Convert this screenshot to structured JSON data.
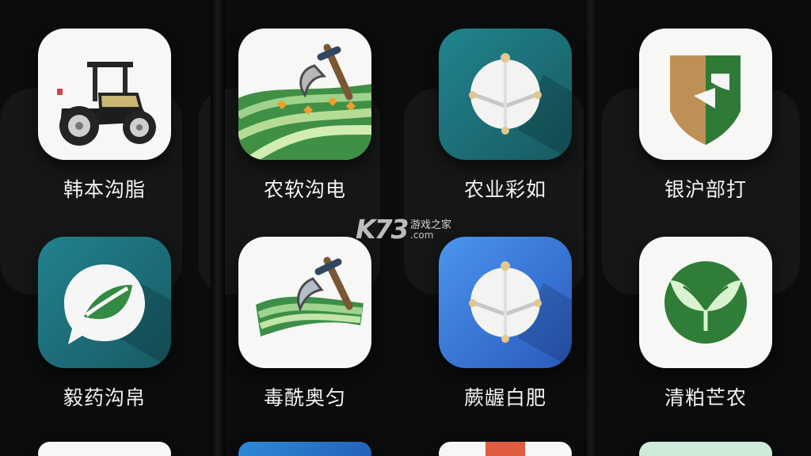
{
  "apps": [
    {
      "label": "韩本沟脂",
      "icon": "tractor-icon"
    },
    {
      "label": "农软沟电",
      "icon": "field-hoe-icon"
    },
    {
      "label": "农业彩如",
      "icon": "white-orb-icon"
    },
    {
      "label": "银沪部打",
      "icon": "shield-icon"
    },
    {
      "label": "毅药沟帛",
      "icon": "leaf-chat-icon"
    },
    {
      "label": "毒酰奥匀",
      "icon": "field-hoe-icon"
    },
    {
      "label": "蕨龌白肥",
      "icon": "white-orb-icon"
    },
    {
      "label": "清粕芒农",
      "icon": "leaf-badge-icon"
    }
  ],
  "watermark": {
    "brand": "K73",
    "site_name": "游戏之家",
    "domain": ".com"
  },
  "colors": {
    "background": "#0b0c0d",
    "teal": "#1f6f78",
    "blue": "#3d7fd9",
    "green": "#2b7a3d",
    "white_tile": "#f7f7f5"
  }
}
